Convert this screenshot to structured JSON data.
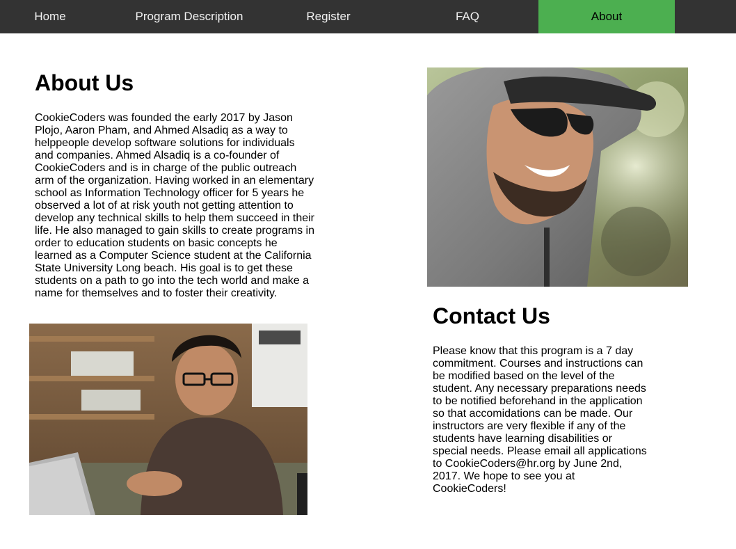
{
  "nav": {
    "items": [
      {
        "label": "Home"
      },
      {
        "label": "Program Description"
      },
      {
        "label": "Register"
      },
      {
        "label": "FAQ"
      },
      {
        "label": "About"
      }
    ],
    "active": "About",
    "colors": {
      "bar": "#333333",
      "active": "#4caf50"
    }
  },
  "about": {
    "title": "About Us",
    "text": "CookieCoders was founded the early 2017 by Jason Plojo, Aaron Pham, and Ahmed Alsadiq as a way to helppeople develop software solutions for individuals and companies. Ahmed Alsadiq is a co-founder of CookieCoders and is in charge of the public outreach arm of the organization. Having worked in an elementary school as Information Technology officer for 5 years he observed a lot of at risk youth not getting attention to develop any technical skills to help them succeed in their life. He also managed to gain skills to create programs in order to education students on basic concepts he learned as a Computer Science student at the California State University Long beach. His goal is to get these students on a path to go into the tech world and make a name for themselves and to foster their creativity."
  },
  "contact": {
    "title": "Contact Us",
    "text": "Please know that this program is a 7 day commitment. Courses and instructions can be modified based on the level of the student. Any necessary preparations needs to be notified beforehand in the application so that accomidations can be made. Our instructors are very flexible if any of the students have learning disabilities or special needs. Please email all applications to CookieCoders@hr.org by June 2nd, 2017. We hope to see you at CookieCoders!"
  }
}
